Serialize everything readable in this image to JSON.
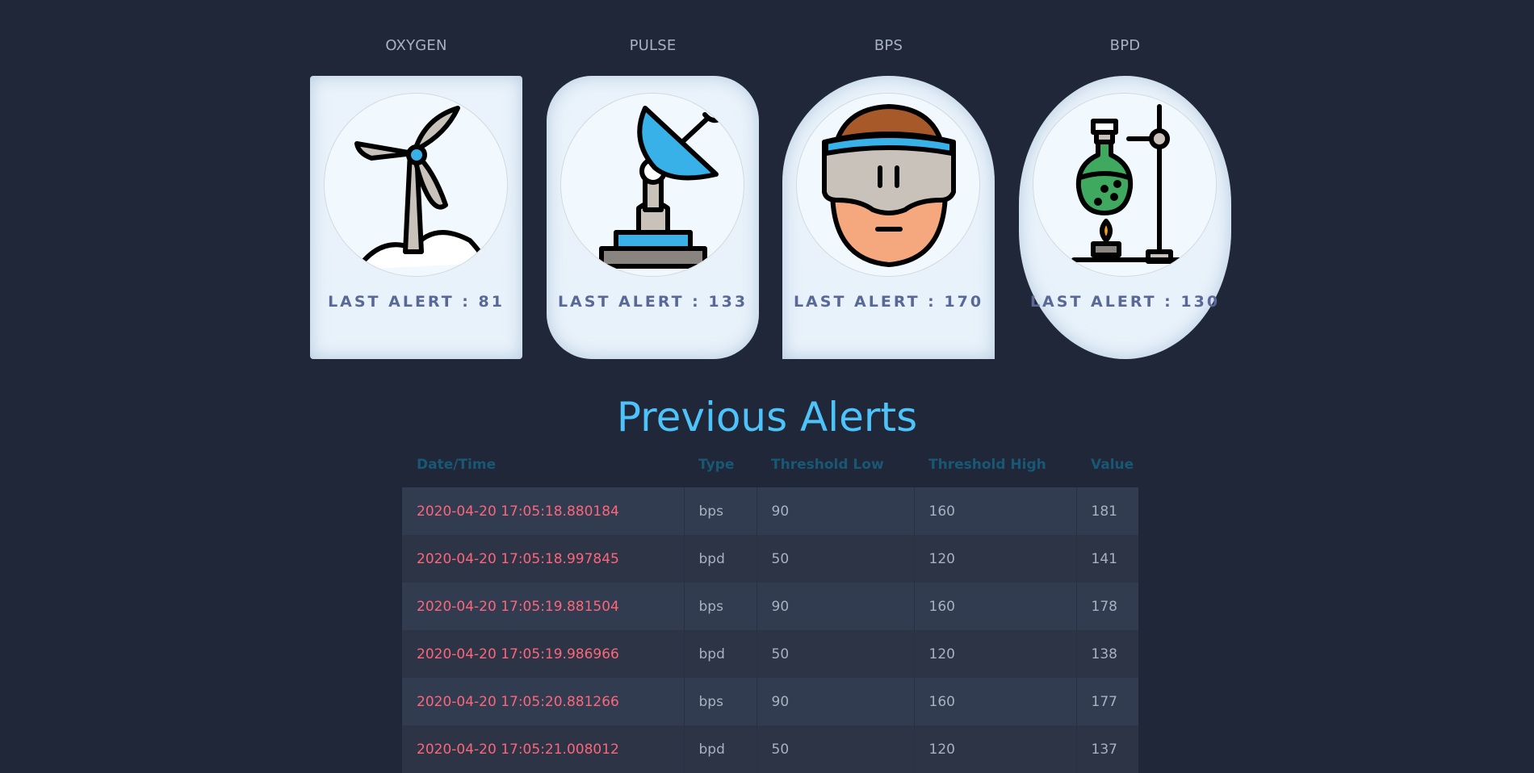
{
  "cards": [
    {
      "title": "OXYGEN",
      "alert_label": "LAST ALERT : 81",
      "icon": "wind-turbine-icon"
    },
    {
      "title": "PULSE",
      "alert_label": "LAST ALERT : 133",
      "icon": "satellite-dish-icon"
    },
    {
      "title": "BPS",
      "alert_label": "LAST ALERT : 170",
      "icon": "vr-headset-person-icon"
    },
    {
      "title": "BPD",
      "alert_label": "LAST ALERT : 130",
      "icon": "chemistry-flask-icon"
    }
  ],
  "alerts": {
    "title": "Previous Alerts",
    "columns": [
      "Date/Time",
      "Type",
      "Threshold Low",
      "Threshold High",
      "Value"
    ],
    "rows": [
      {
        "datetime": "2020-04-20 17:05:18.880184",
        "type": "bps",
        "low": "90",
        "high": "160",
        "value": "181"
      },
      {
        "datetime": "2020-04-20 17:05:18.997845",
        "type": "bpd",
        "low": "50",
        "high": "120",
        "value": "141"
      },
      {
        "datetime": "2020-04-20 17:05:19.881504",
        "type": "bps",
        "low": "90",
        "high": "160",
        "value": "178"
      },
      {
        "datetime": "2020-04-20 17:05:19.986966",
        "type": "bpd",
        "low": "50",
        "high": "120",
        "value": "138"
      },
      {
        "datetime": "2020-04-20 17:05:20.881266",
        "type": "bps",
        "low": "90",
        "high": "160",
        "value": "177"
      },
      {
        "datetime": "2020-04-20 17:05:21.008012",
        "type": "bpd",
        "low": "50",
        "high": "120",
        "value": "137"
      }
    ]
  },
  "colors": {
    "background": "#1f2739",
    "accent": "#4dc3fa",
    "header_text": "#185875",
    "datetime_text": "#fb667a",
    "card_label": "#5a6897"
  }
}
